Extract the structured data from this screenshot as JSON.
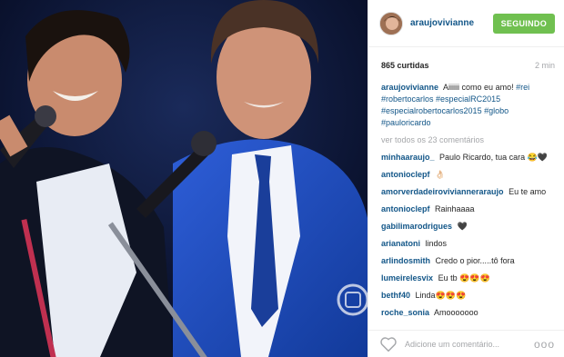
{
  "header": {
    "username": "araujovivianne",
    "follow_label": "SEGUINDO"
  },
  "meta": {
    "likes": "865 curtidas",
    "time": "2 min"
  },
  "caption": {
    "username": "araujovivianne",
    "text": "Aiiiiii como eu amo!",
    "tags": [
      "#rei",
      "#robertocarlos",
      "#especialRC2015",
      "#especialrobertocarlos2015",
      "#globo",
      "#pauloricardo"
    ]
  },
  "view_all": "ver todos os 23 comentários",
  "comments": [
    {
      "user": "minhaaraujo_",
      "text": "Paulo Ricardo, tua cara 😂🖤"
    },
    {
      "user": "antonioclepf",
      "text": "👌🏻"
    },
    {
      "user": "amorverdadeirovivianneraraujo",
      "text": "Eu te amo"
    },
    {
      "user": "antonioclepf",
      "text": "Rainhaaaa"
    },
    {
      "user": "gabilimarodrigues",
      "text": "🖤"
    },
    {
      "user": "arianatoni",
      "text": "lindos"
    },
    {
      "user": "arlindosmith",
      "text": "Credo o pior.....tô fora"
    },
    {
      "user": "lumeirelesvix",
      "text": "Eu tb 😍😍😍"
    },
    {
      "user": "bethf40",
      "text": "Linda😍😍😍"
    },
    {
      "user": "roche_sonia",
      "text": "Amooooooo"
    }
  ],
  "footer": {
    "add_comment_placeholder": "Adicione um comentário...",
    "more_label": "ooo"
  },
  "colors": {
    "link": "#125688",
    "follow_bg": "#70c050",
    "muted": "#a5a7aa"
  },
  "icons": [
    "heart-icon",
    "more-options-icon",
    "avatar"
  ]
}
